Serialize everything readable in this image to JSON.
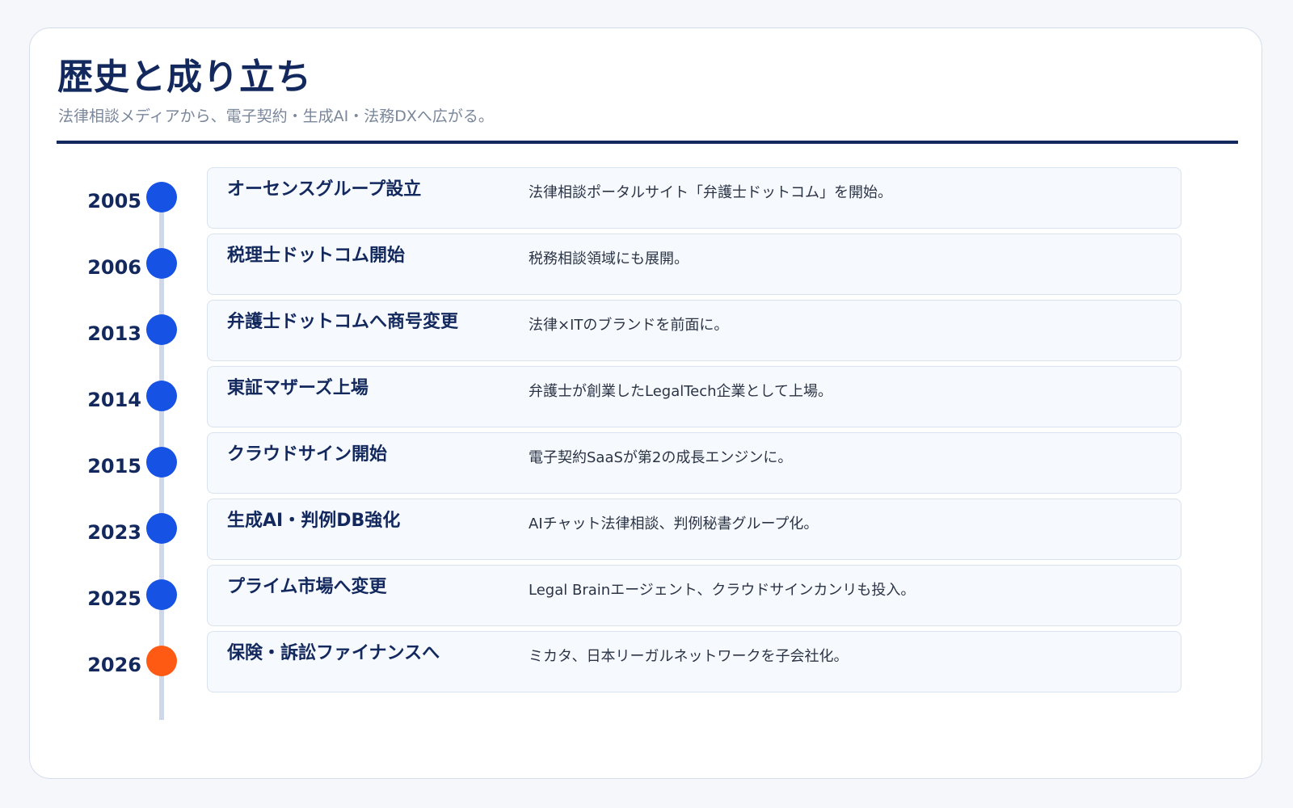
{
  "header": {
    "title": "歴史と成り立ち",
    "subtitle": "法律相談メディアから、電子契約・生成AI・法務DXへ広がる。"
  },
  "timeline": [
    {
      "year": "2005",
      "event": "オーセンスグループ設立",
      "description": "法律相談ポータルサイト「弁護士ドットコム」を開始。"
    },
    {
      "year": "2006",
      "event": "税理士ドットコム開始",
      "description": "税務相談領域にも展開。"
    },
    {
      "year": "2013",
      "event": "弁護士ドットコムへ商号変更",
      "description": "法律×ITのブランドを前面に。"
    },
    {
      "year": "2014",
      "event": "東証マザーズ上場",
      "description": "弁護士が創業したLegalTech企業として上場。"
    },
    {
      "year": "2015",
      "event": "クラウドサイン開始",
      "description": "電子契約SaaSが第2の成長エンジンに。"
    },
    {
      "year": "2023",
      "event": "生成AI・判例DB強化",
      "description": "AIチャット法律相談、判例秘書グループ化。"
    },
    {
      "year": "2025",
      "event": "プライム市場へ変更",
      "description": "Legal Brainエージェント、クラウドサインカンリも投入。"
    },
    {
      "year": "2026",
      "event": "保険・訴訟ファイナンスへ",
      "description": "ミカタ、日本リーガルネットワークを子会社化。"
    }
  ],
  "colors": {
    "accent": "#1652e3",
    "highlight": "#ff5a14",
    "navy": "#13295e"
  }
}
